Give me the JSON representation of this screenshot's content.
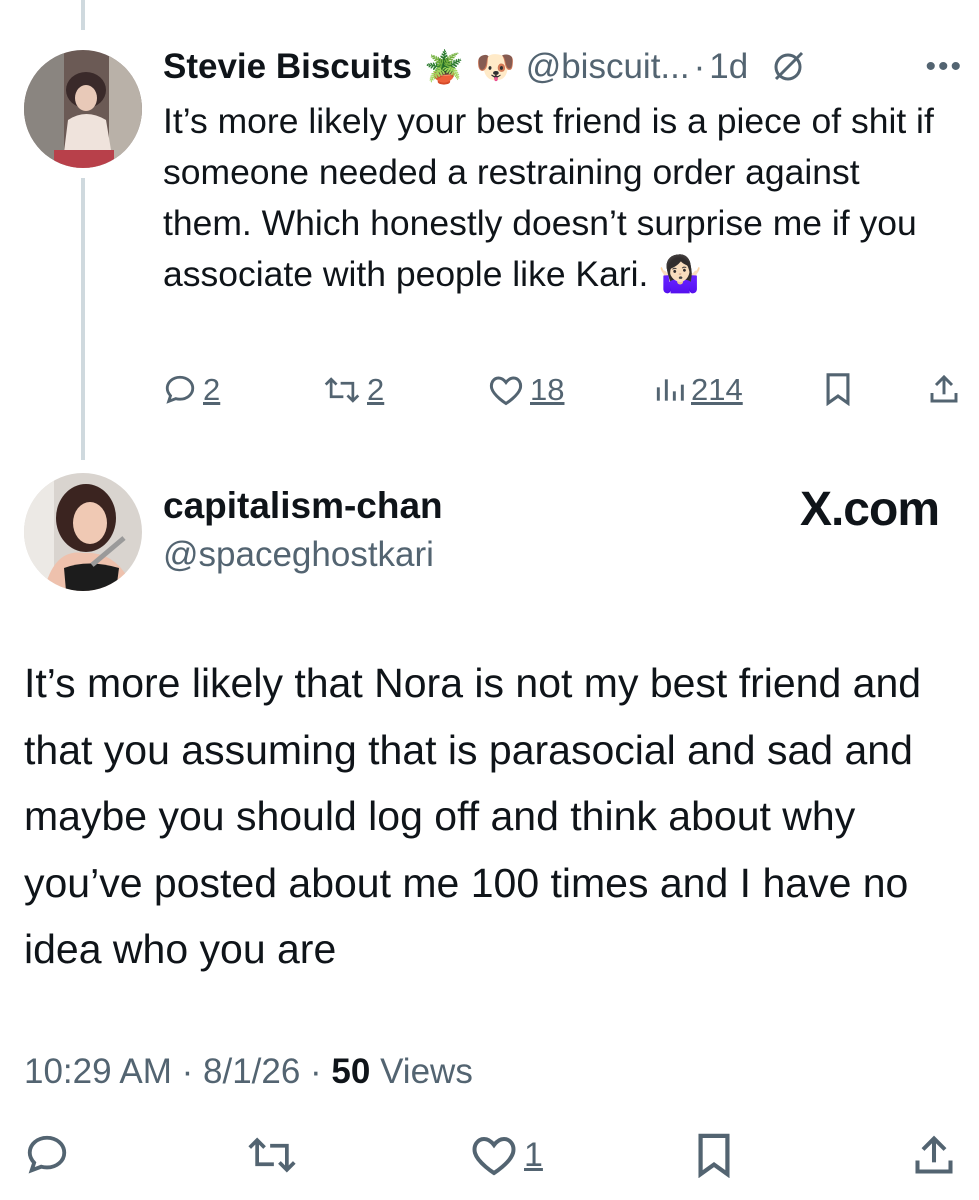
{
  "reply": {
    "display_name": "Stevie Biscuits",
    "emoji_1": "🪴",
    "emoji_2": "🐶",
    "handle": "@biscuit...",
    "separator": "·",
    "time_ago": "1d",
    "text": "It’s more likely your best friend is a piece of shit if someone needed a restraining order against them. Which honestly doesn’t surprise me if you associate with people like Kari. 🤷🏻‍♀️",
    "more_icon": "more-icon",
    "stats": {
      "replies": "2",
      "reposts": "2",
      "likes": "18",
      "views": "214"
    }
  },
  "main_post": {
    "display_name": "capitalism-chan",
    "handle": "@spaceghostkari",
    "brand": "X.com",
    "text": "It’s more likely that Nora is not my best friend and that you assuming that is parasocial and sad and maybe you should log off and think about why you’ve posted about me 100 times and I have no idea who you are",
    "time": "10:29 AM",
    "date": "8/1/26",
    "views_count": "50",
    "views_label": "Views",
    "separator": " · ",
    "stats": {
      "likes": "1"
    }
  },
  "icons": [
    "reply-icon",
    "repost-icon",
    "like-icon",
    "views-icon",
    "bookmark-icon",
    "share-icon",
    "grok-icon"
  ],
  "colors": {
    "text": "#0f1419",
    "secondary": "#536471",
    "thread_line": "#cfd9de"
  }
}
